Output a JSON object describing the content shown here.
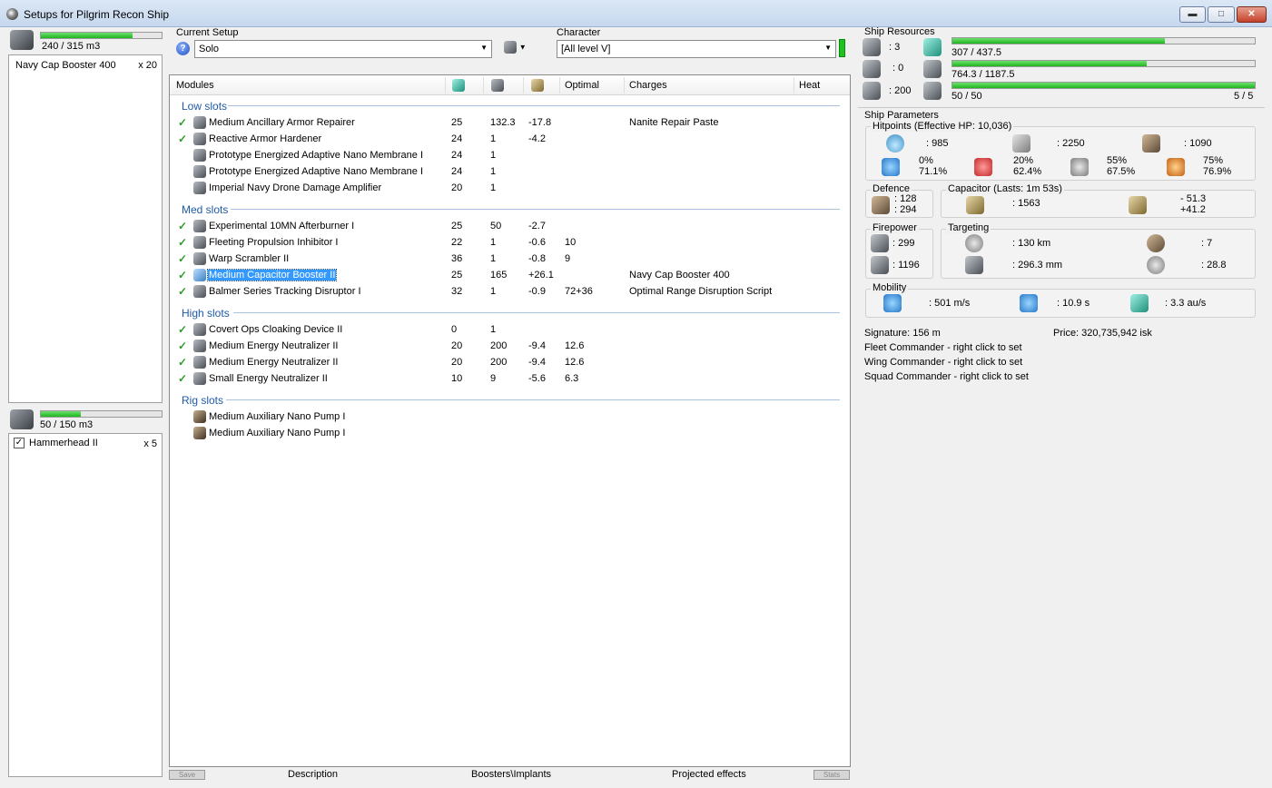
{
  "window": {
    "title": "Setups for Pilgrim Recon Ship",
    "buttons": {
      "minimize": "▬",
      "maximize": "□",
      "close": "✕"
    }
  },
  "cargo": {
    "capacity_text": "240 / 315 m3",
    "fill_fraction": 0.762,
    "items": [
      {
        "name": "Navy Cap Booster 400",
        "qty": "x 20"
      }
    ]
  },
  "drones": {
    "capacity_text": "50 / 150 m3",
    "fill_fraction": 0.333,
    "items": [
      {
        "name": "Hammerhead II",
        "qty": "x 5",
        "checked": "✓"
      }
    ]
  },
  "setup": {
    "label": "Current Setup",
    "value": "Solo",
    "help": "?",
    "menu_arrow": "▼"
  },
  "character": {
    "label": "Character",
    "value": "[All level V]",
    "arrow": "▼",
    "status_color": "#1fc21f"
  },
  "modules": {
    "columns": {
      "modules": "Modules",
      "optimal": "Optimal",
      "charges": "Charges",
      "heat": "Heat"
    },
    "groups": {
      "low": {
        "title": "Low slots",
        "rows": [
          {
            "name": "Medium Ancillary Armor Repairer",
            "cpu": "25",
            "pg": "132.3",
            "cap": "-17.8",
            "optimal": "",
            "charges": "Nanite Repair Paste",
            "online": "✓"
          },
          {
            "name": "Reactive Armor Hardener",
            "cpu": "24",
            "pg": "1",
            "cap": "-4.2",
            "optimal": "",
            "charges": "",
            "online": "✓"
          },
          {
            "name": "Prototype Energized Adaptive Nano Membrane I",
            "cpu": "24",
            "pg": "1",
            "cap": "",
            "optimal": "",
            "charges": "",
            "online": ""
          },
          {
            "name": "Prototype Energized Adaptive Nano Membrane I",
            "cpu": "24",
            "pg": "1",
            "cap": "",
            "optimal": "",
            "charges": "",
            "online": ""
          },
          {
            "name": "Imperial Navy Drone Damage Amplifier",
            "cpu": "20",
            "pg": "1",
            "cap": "",
            "optimal": "",
            "charges": "",
            "online": ""
          }
        ]
      },
      "med": {
        "title": "Med slots",
        "rows": [
          {
            "name": "Experimental 10MN Afterburner I",
            "cpu": "25",
            "pg": "50",
            "cap": "-2.7",
            "optimal": "",
            "charges": "",
            "online": "✓"
          },
          {
            "name": "Fleeting Propulsion Inhibitor I",
            "cpu": "22",
            "pg": "1",
            "cap": "-0.6",
            "optimal": "10",
            "charges": "",
            "online": "✓"
          },
          {
            "name": "Warp Scrambler II",
            "cpu": "36",
            "pg": "1",
            "cap": "-0.8",
            "optimal": "9",
            "charges": "",
            "online": "✓"
          },
          {
            "name": "Medium Capacitor Booster II",
            "cpu": "25",
            "pg": "165",
            "cap": "+26.1",
            "optimal": "",
            "charges": "Navy Cap Booster 400",
            "online": "✓"
          },
          {
            "name": "Balmer Series Tracking Disruptor I",
            "cpu": "32",
            "pg": "1",
            "cap": "-0.9",
            "optimal": "72+36",
            "charges": "Optimal Range Disruption Script",
            "online": "✓"
          }
        ]
      },
      "high": {
        "title": "High slots",
        "rows": [
          {
            "name": "Covert Ops Cloaking Device II",
            "cpu": "0",
            "pg": "1",
            "cap": "",
            "optimal": "",
            "charges": "",
            "online": "✓"
          },
          {
            "name": "Medium Energy Neutralizer II",
            "cpu": "20",
            "pg": "200",
            "cap": "-9.4",
            "optimal": "12.6",
            "charges": "",
            "online": "✓"
          },
          {
            "name": "Medium Energy Neutralizer II",
            "cpu": "20",
            "pg": "200",
            "cap": "-9.4",
            "optimal": "12.6",
            "charges": "",
            "online": "✓"
          },
          {
            "name": "Small Energy Neutralizer II",
            "cpu": "10",
            "pg": "9",
            "cap": "-5.6",
            "optimal": "6.3",
            "charges": "",
            "online": "✓"
          }
        ]
      },
      "rig": {
        "title": "Rig slots",
        "rows": [
          {
            "name": "Medium Auxiliary Nano Pump I",
            "cpu": "",
            "pg": "",
            "cap": "",
            "optimal": "",
            "charges": "",
            "online": ""
          },
          {
            "name": "Medium Auxiliary Nano Pump I",
            "cpu": "",
            "pg": "",
            "cap": "",
            "optimal": "",
            "charges": "",
            "online": ""
          }
        ]
      }
    }
  },
  "bottom_tabs": {
    "left_btn": "Save",
    "description": "Description",
    "boosters": "Boosters\\Implants",
    "projected": "Projected effects",
    "right_btn": "Stats"
  },
  "resources": {
    "title": "Ship Resources",
    "turret_hardpoints": ": 3",
    "launcher_hardpoints": ": 0",
    "drone_bandwidth": ": 200",
    "cpu": {
      "text": "307 / 437.5",
      "fraction": 0.702
    },
    "powergrid": {
      "text": "764.3 / 1187.5",
      "fraction": 0.644
    },
    "drones": {
      "text": "50 / 50",
      "right": "5 / 5",
      "fraction": 1.0
    }
  },
  "params": {
    "title": "Ship Parameters",
    "hitpoints": {
      "title": "Hitpoints (Effective HP: 10,036)",
      "shield": ": 985",
      "armor": ": 2250",
      "structure": ": 1090",
      "resists": [
        {
          "top": "0%",
          "bottom": "71.1%"
        },
        {
          "top": "20%",
          "bottom": "62.4%"
        },
        {
          "top": "55%",
          "bottom": "67.5%"
        },
        {
          "top": "75%",
          "bottom": "76.9%"
        }
      ]
    },
    "defence": {
      "title": "Defence",
      "top": ": 128",
      "bottom": ": 294"
    },
    "capacitor": {
      "title": "Capacitor (Lasts: 1m 53s)",
      "amount": ": 1563",
      "top": "- 51.3",
      "bottom": "+41.2"
    },
    "firepower": {
      "title": "Firepower",
      "dps": ": 299",
      "volley": ": 1196"
    },
    "targeting": {
      "title": "Targeting",
      "range": ": 130 km",
      "targets": ": 7",
      "scan_res": ": 296.3 mm",
      "sensor": ": 28.8"
    },
    "mobility": {
      "title": "Mobility",
      "speed": ": 501 m/s",
      "align": ": 10.9 s",
      "warp": ": 3.3 au/s"
    },
    "signature": "Signature: 156 m",
    "price": "Price: 320,735,942 isk",
    "fleet_commander": "Fleet Commander - right click to set",
    "wing_commander": "Wing Commander - right click to set",
    "squad_commander": "Squad Commander - right click to set"
  }
}
